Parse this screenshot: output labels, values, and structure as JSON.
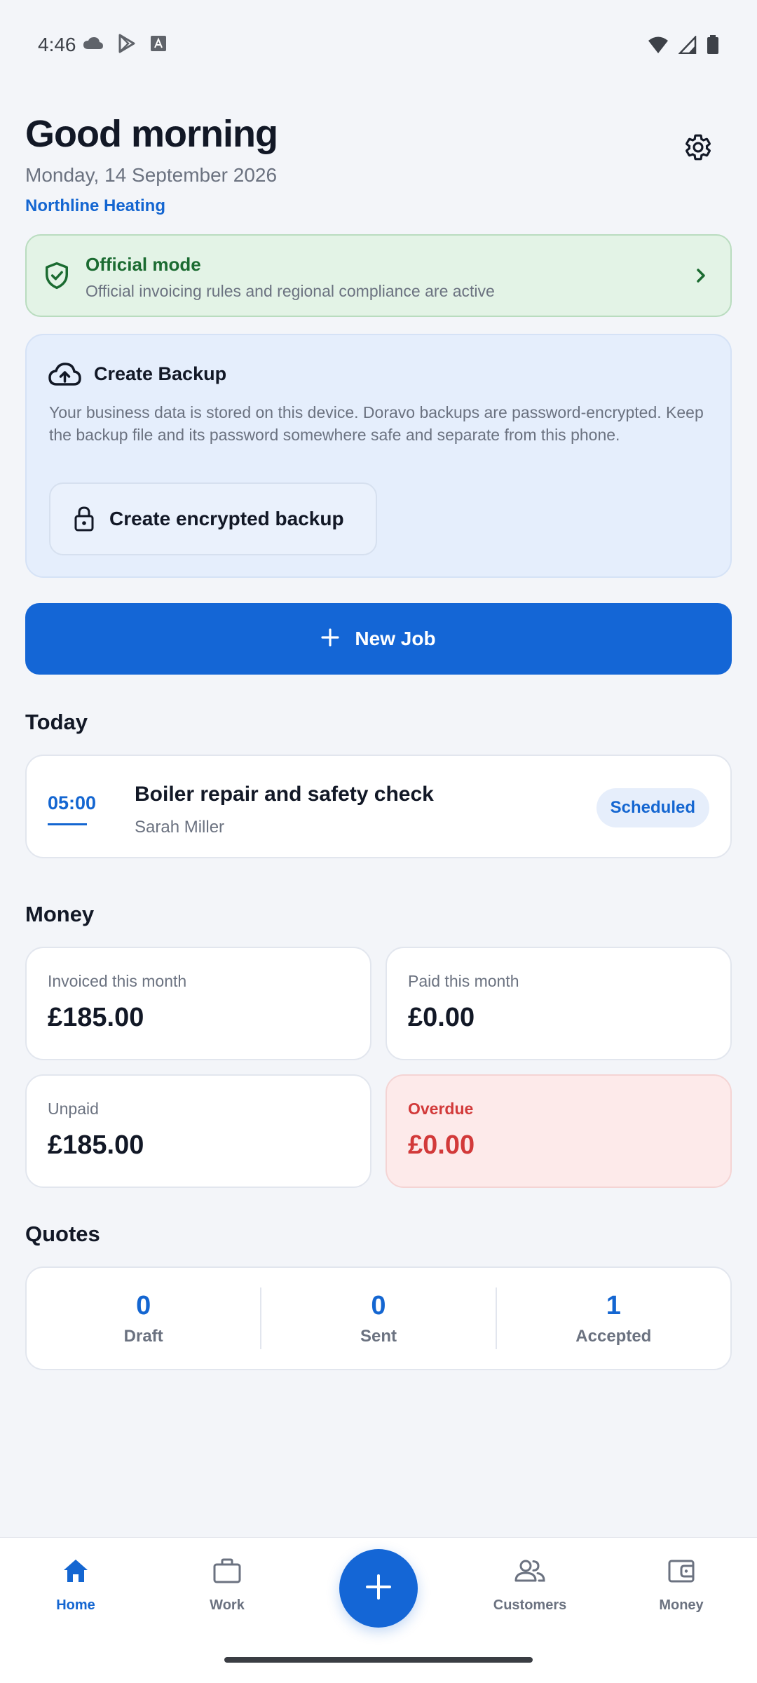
{
  "status_bar": {
    "time": "4:46"
  },
  "header": {
    "greeting": "Good morning",
    "date": "Monday, 14 September 2026",
    "business_name": "Northline Heating"
  },
  "official_mode": {
    "title": "Official mode",
    "subtitle": "Official invoicing rules and regional compliance are active"
  },
  "backup": {
    "title": "Create Backup",
    "description": "Your business data is stored on this device. Doravo backups are password-encrypted. Keep the backup file and its password somewhere safe and separate from this phone.",
    "button_label": "Create encrypted backup"
  },
  "new_job": {
    "label": "New Job"
  },
  "today": {
    "heading": "Today",
    "jobs": [
      {
        "time": "05:00",
        "title": "Boiler repair and safety check",
        "customer": "Sarah Miller",
        "status": "Scheduled"
      }
    ]
  },
  "money": {
    "heading": "Money",
    "tiles": [
      {
        "label": "Invoiced this month",
        "value": "£185.00"
      },
      {
        "label": "Paid this month",
        "value": "£0.00"
      },
      {
        "label": "Unpaid",
        "value": "£185.00"
      },
      {
        "label": "Overdue",
        "value": "£0.00"
      }
    ]
  },
  "quotes": {
    "heading": "Quotes",
    "items": [
      {
        "count": "0",
        "label": "Draft"
      },
      {
        "count": "0",
        "label": "Sent"
      },
      {
        "count": "1",
        "label": "Accepted"
      }
    ]
  },
  "nav": {
    "items": [
      {
        "label": "Home",
        "icon": "home-icon",
        "active": true
      },
      {
        "label": "Work",
        "icon": "briefcase-icon",
        "active": false
      },
      {
        "label": "Customers",
        "icon": "people-icon",
        "active": false
      },
      {
        "label": "Money",
        "icon": "wallet-icon",
        "active": false
      }
    ]
  },
  "colors": {
    "primary": "#1466d6",
    "success": "#1b6b31",
    "danger": "#d23a3a",
    "background": "#f3f5f9"
  }
}
